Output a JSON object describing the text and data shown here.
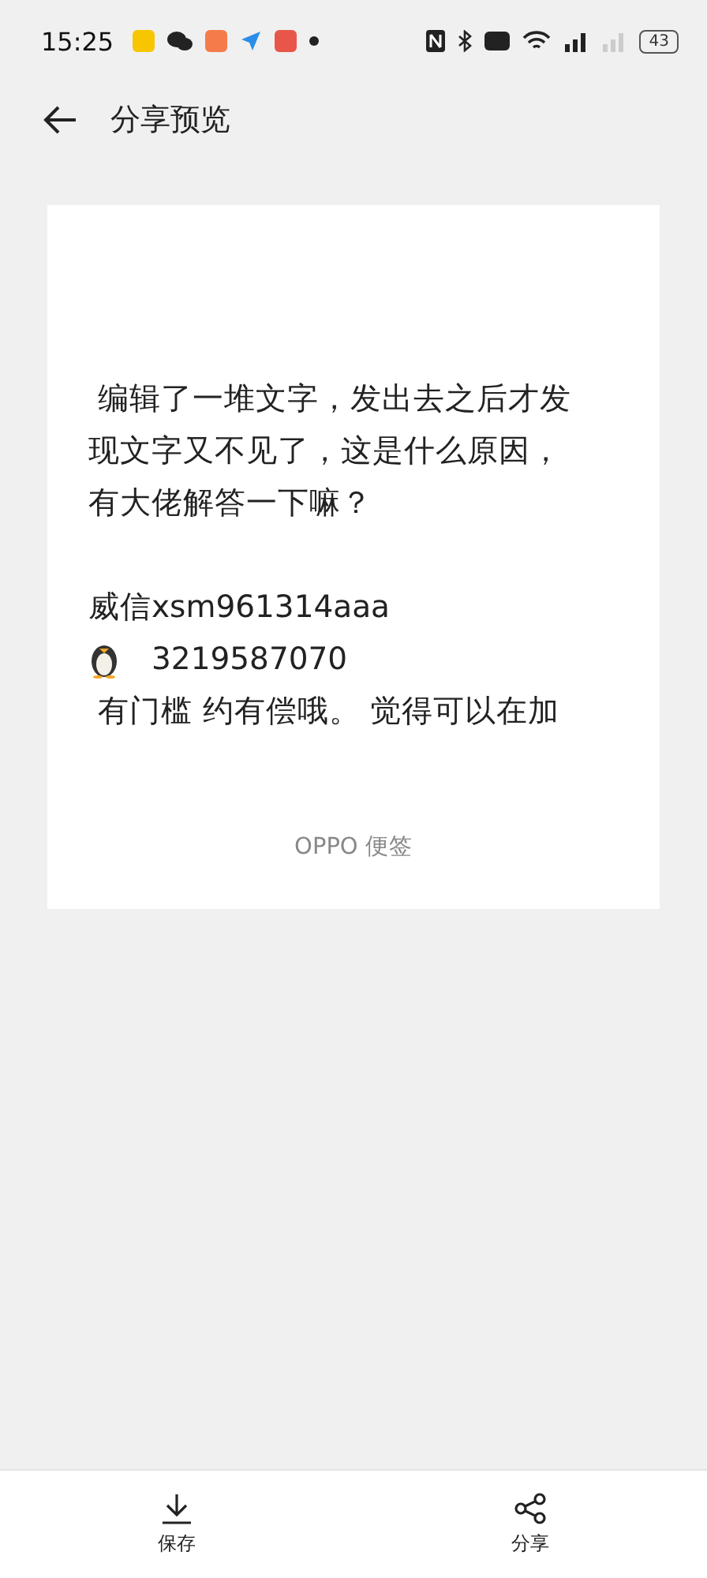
{
  "status_bar": {
    "time": "15:25",
    "battery": "43"
  },
  "header": {
    "title": "分享预览"
  },
  "note": {
    "lines": [
      {
        "text": " 编辑了一堆文字，发出去之后才发"
      },
      {
        "text": "现文字又不见了，这是什么原因，"
      },
      {
        "text": "有大佬解答一下嘛？"
      },
      {
        "kind": "blank"
      },
      {
        "text": "威信xsm961314aaa"
      },
      {
        "text": "3219587070",
        "kind": "penguin"
      },
      {
        "text": " 有门槛 约有偿哦。 觉得可以在加"
      }
    ],
    "footer": "OPPO 便签"
  },
  "bottom_bar": [
    {
      "label": "保存",
      "kind": "save"
    },
    {
      "label": "分享",
      "kind": "share"
    }
  ]
}
